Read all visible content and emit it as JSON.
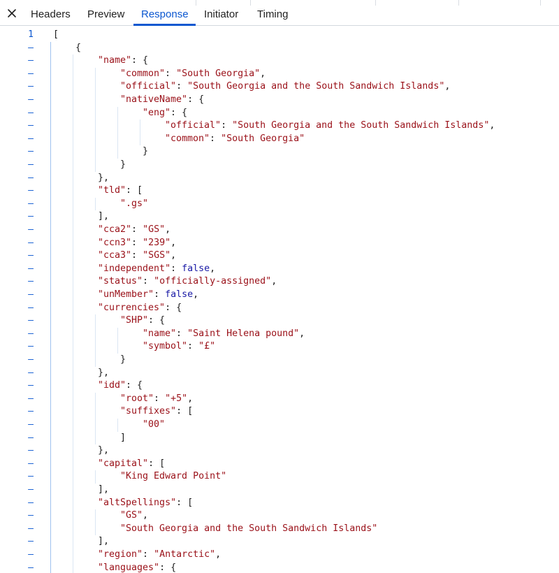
{
  "tabs": {
    "items": [
      {
        "label": "Headers"
      },
      {
        "label": "Preview"
      },
      {
        "label": "Response",
        "active": true
      },
      {
        "label": "Initiator"
      },
      {
        "label": "Timing"
      }
    ]
  },
  "icons": {
    "close": "close-icon"
  },
  "colors": {
    "accent": "#0b57d0",
    "key": "#9a1018",
    "string": "#9a1018",
    "keyword": "#1a1aa6"
  },
  "code": {
    "first_line_number": "1",
    "collapse_marker": "–",
    "lines": [
      {
        "i": 0,
        "parts": [
          {
            "c": "p",
            "t": "["
          }
        ]
      },
      {
        "i": 1,
        "parts": [
          {
            "c": "p",
            "t": "{"
          }
        ]
      },
      {
        "i": 2,
        "parts": [
          {
            "c": "k",
            "t": "\"name\""
          },
          {
            "c": "p",
            "t": ": {"
          }
        ]
      },
      {
        "i": 3,
        "parts": [
          {
            "c": "k",
            "t": "\"common\""
          },
          {
            "c": "p",
            "t": ": "
          },
          {
            "c": "s",
            "t": "\"South Georgia\""
          },
          {
            "c": "p",
            "t": ","
          }
        ]
      },
      {
        "i": 3,
        "parts": [
          {
            "c": "k",
            "t": "\"official\""
          },
          {
            "c": "p",
            "t": ": "
          },
          {
            "c": "s",
            "t": "\"South Georgia and the South Sandwich Islands\""
          },
          {
            "c": "p",
            "t": ","
          }
        ]
      },
      {
        "i": 3,
        "parts": [
          {
            "c": "k",
            "t": "\"nativeName\""
          },
          {
            "c": "p",
            "t": ": {"
          }
        ]
      },
      {
        "i": 4,
        "parts": [
          {
            "c": "k",
            "t": "\"eng\""
          },
          {
            "c": "p",
            "t": ": {"
          }
        ]
      },
      {
        "i": 5,
        "parts": [
          {
            "c": "k",
            "t": "\"official\""
          },
          {
            "c": "p",
            "t": ": "
          },
          {
            "c": "s",
            "t": "\"South Georgia and the South Sandwich Islands\""
          },
          {
            "c": "p",
            "t": ","
          }
        ]
      },
      {
        "i": 5,
        "parts": [
          {
            "c": "k",
            "t": "\"common\""
          },
          {
            "c": "p",
            "t": ": "
          },
          {
            "c": "s",
            "t": "\"South Georgia\""
          }
        ]
      },
      {
        "i": 4,
        "parts": [
          {
            "c": "p",
            "t": "}"
          }
        ]
      },
      {
        "i": 3,
        "parts": [
          {
            "c": "p",
            "t": "}"
          }
        ]
      },
      {
        "i": 2,
        "parts": [
          {
            "c": "p",
            "t": "},"
          }
        ]
      },
      {
        "i": 2,
        "parts": [
          {
            "c": "k",
            "t": "\"tld\""
          },
          {
            "c": "p",
            "t": ": ["
          }
        ]
      },
      {
        "i": 3,
        "parts": [
          {
            "c": "s",
            "t": "\".gs\""
          }
        ]
      },
      {
        "i": 2,
        "parts": [
          {
            "c": "p",
            "t": "],"
          }
        ]
      },
      {
        "i": 2,
        "parts": [
          {
            "c": "k",
            "t": "\"cca2\""
          },
          {
            "c": "p",
            "t": ": "
          },
          {
            "c": "s",
            "t": "\"GS\""
          },
          {
            "c": "p",
            "t": ","
          }
        ]
      },
      {
        "i": 2,
        "parts": [
          {
            "c": "k",
            "t": "\"ccn3\""
          },
          {
            "c": "p",
            "t": ": "
          },
          {
            "c": "s",
            "t": "\"239\""
          },
          {
            "c": "p",
            "t": ","
          }
        ]
      },
      {
        "i": 2,
        "parts": [
          {
            "c": "k",
            "t": "\"cca3\""
          },
          {
            "c": "p",
            "t": ": "
          },
          {
            "c": "s",
            "t": "\"SGS\""
          },
          {
            "c": "p",
            "t": ","
          }
        ]
      },
      {
        "i": 2,
        "parts": [
          {
            "c": "k",
            "t": "\"independent\""
          },
          {
            "c": "p",
            "t": ": "
          },
          {
            "c": "kw",
            "t": "false"
          },
          {
            "c": "p",
            "t": ","
          }
        ]
      },
      {
        "i": 2,
        "parts": [
          {
            "c": "k",
            "t": "\"status\""
          },
          {
            "c": "p",
            "t": ": "
          },
          {
            "c": "s",
            "t": "\"officially-assigned\""
          },
          {
            "c": "p",
            "t": ","
          }
        ]
      },
      {
        "i": 2,
        "parts": [
          {
            "c": "k",
            "t": "\"unMember\""
          },
          {
            "c": "p",
            "t": ": "
          },
          {
            "c": "kw",
            "t": "false"
          },
          {
            "c": "p",
            "t": ","
          }
        ]
      },
      {
        "i": 2,
        "parts": [
          {
            "c": "k",
            "t": "\"currencies\""
          },
          {
            "c": "p",
            "t": ": {"
          }
        ]
      },
      {
        "i": 3,
        "parts": [
          {
            "c": "k",
            "t": "\"SHP\""
          },
          {
            "c": "p",
            "t": ": {"
          }
        ]
      },
      {
        "i": 4,
        "parts": [
          {
            "c": "k",
            "t": "\"name\""
          },
          {
            "c": "p",
            "t": ": "
          },
          {
            "c": "s",
            "t": "\"Saint Helena pound\""
          },
          {
            "c": "p",
            "t": ","
          }
        ]
      },
      {
        "i": 4,
        "parts": [
          {
            "c": "k",
            "t": "\"symbol\""
          },
          {
            "c": "p",
            "t": ": "
          },
          {
            "c": "s",
            "t": "\"£\""
          }
        ]
      },
      {
        "i": 3,
        "parts": [
          {
            "c": "p",
            "t": "}"
          }
        ]
      },
      {
        "i": 2,
        "parts": [
          {
            "c": "p",
            "t": "},"
          }
        ]
      },
      {
        "i": 2,
        "parts": [
          {
            "c": "k",
            "t": "\"idd\""
          },
          {
            "c": "p",
            "t": ": {"
          }
        ]
      },
      {
        "i": 3,
        "parts": [
          {
            "c": "k",
            "t": "\"root\""
          },
          {
            "c": "p",
            "t": ": "
          },
          {
            "c": "s",
            "t": "\"+5\""
          },
          {
            "c": "p",
            "t": ","
          }
        ]
      },
      {
        "i": 3,
        "parts": [
          {
            "c": "k",
            "t": "\"suffixes\""
          },
          {
            "c": "p",
            "t": ": ["
          }
        ]
      },
      {
        "i": 4,
        "parts": [
          {
            "c": "s",
            "t": "\"00\""
          }
        ]
      },
      {
        "i": 3,
        "parts": [
          {
            "c": "p",
            "t": "]"
          }
        ]
      },
      {
        "i": 2,
        "parts": [
          {
            "c": "p",
            "t": "},"
          }
        ]
      },
      {
        "i": 2,
        "parts": [
          {
            "c": "k",
            "t": "\"capital\""
          },
          {
            "c": "p",
            "t": ": ["
          }
        ]
      },
      {
        "i": 3,
        "parts": [
          {
            "c": "s",
            "t": "\"King Edward Point\""
          }
        ]
      },
      {
        "i": 2,
        "parts": [
          {
            "c": "p",
            "t": "],"
          }
        ]
      },
      {
        "i": 2,
        "parts": [
          {
            "c": "k",
            "t": "\"altSpellings\""
          },
          {
            "c": "p",
            "t": ": ["
          }
        ]
      },
      {
        "i": 3,
        "parts": [
          {
            "c": "s",
            "t": "\"GS\""
          },
          {
            "c": "p",
            "t": ","
          }
        ]
      },
      {
        "i": 3,
        "parts": [
          {
            "c": "s",
            "t": "\"South Georgia and the South Sandwich Islands\""
          }
        ]
      },
      {
        "i": 2,
        "parts": [
          {
            "c": "p",
            "t": "],"
          }
        ]
      },
      {
        "i": 2,
        "parts": [
          {
            "c": "k",
            "t": "\"region\""
          },
          {
            "c": "p",
            "t": ": "
          },
          {
            "c": "s",
            "t": "\"Antarctic\""
          },
          {
            "c": "p",
            "t": ","
          }
        ]
      },
      {
        "i": 2,
        "parts": [
          {
            "c": "k",
            "t": "\"languages\""
          },
          {
            "c": "p",
            "t": ": {"
          }
        ]
      }
    ]
  }
}
